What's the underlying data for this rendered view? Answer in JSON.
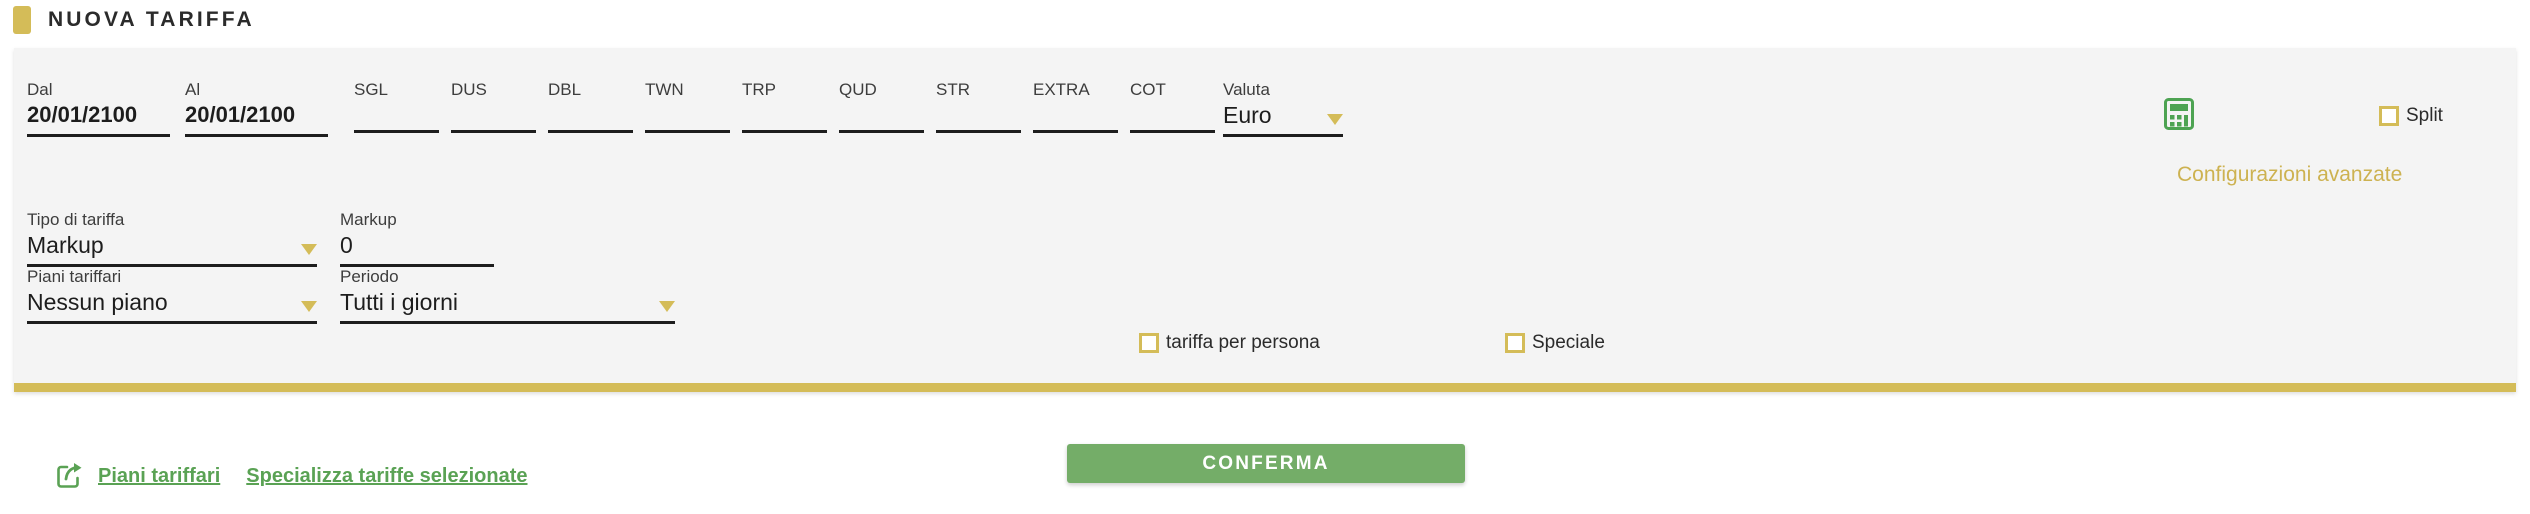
{
  "header": {
    "title": "NUOVA TARIFFA",
    "chip_color": "#d4bc58"
  },
  "panel": {
    "accent_color": "#d4bc58",
    "background": "#f4f4f4"
  },
  "dates": {
    "from": {
      "label": "Dal",
      "value": "20/01/2100"
    },
    "to": {
      "label": "Al",
      "value": "20/01/2100"
    }
  },
  "rate_columns": [
    {
      "label": "SGL",
      "value": ""
    },
    {
      "label": "DUS",
      "value": ""
    },
    {
      "label": "DBL",
      "value": ""
    },
    {
      "label": "TWN",
      "value": ""
    },
    {
      "label": "TRP",
      "value": ""
    },
    {
      "label": "QUD",
      "value": ""
    },
    {
      "label": "STR",
      "value": ""
    },
    {
      "label": "EXTRA",
      "value": ""
    },
    {
      "label": "COT",
      "value": ""
    }
  ],
  "currency": {
    "label": "Valuta",
    "value": "Euro"
  },
  "calculator_icon": "calculator-icon",
  "split": {
    "label": "Split",
    "checked": false
  },
  "advanced_link": "Configurazioni avanzate",
  "rate_type": {
    "label": "Tipo di tariffa",
    "value": "Markup"
  },
  "markup": {
    "label": "Markup",
    "value": "0"
  },
  "rate_plans": {
    "label": "Piani tariffari",
    "value": "Nessun piano"
  },
  "period": {
    "label": "Periodo",
    "value": "Tutti i giorni"
  },
  "per_person": {
    "label": "tariffa per persona",
    "checked": false
  },
  "special": {
    "label": "Speciale",
    "checked": false
  },
  "footer": {
    "share_icon": "share-arrow-icon",
    "link_plans": "Piani tariffari",
    "link_specialize": "Specializza tariffe selezionate",
    "confirm_button": "CONFERMA",
    "confirm_color": "#74ad68"
  }
}
